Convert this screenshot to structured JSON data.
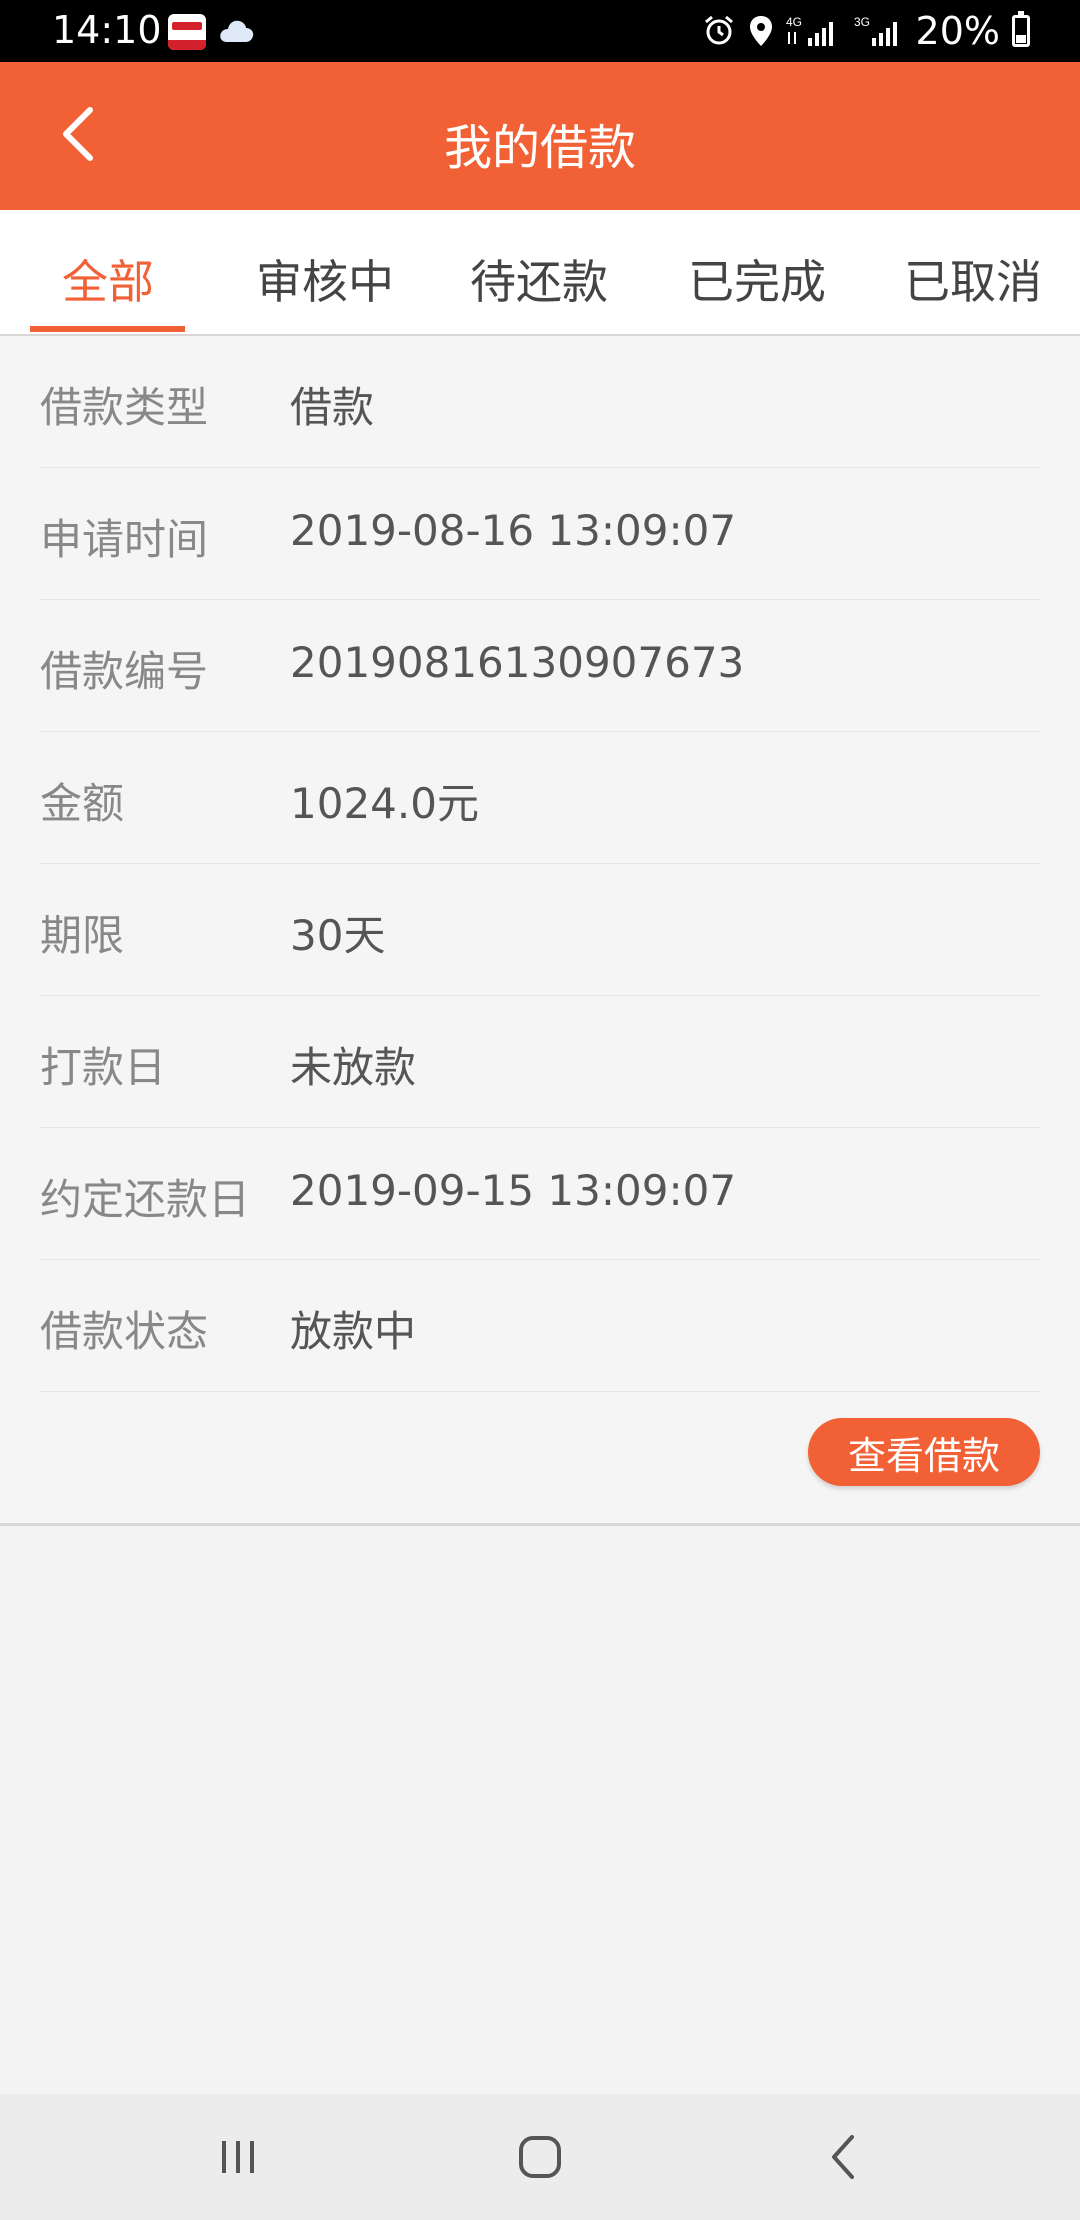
{
  "status_bar": {
    "time": "14:10",
    "battery": "20%",
    "icons": [
      "app-notification-icon",
      "cloud-icon",
      "alarm-icon",
      "location-icon",
      "signal-4g-icon",
      "signal-3g-icon",
      "battery-charging-icon"
    ]
  },
  "header": {
    "title": "我的借款",
    "back_icon": "chevron-left-icon"
  },
  "tabs": [
    {
      "label": "全部",
      "active": true
    },
    {
      "label": "审核中",
      "active": false
    },
    {
      "label": "待还款",
      "active": false
    },
    {
      "label": "已完成",
      "active": false
    },
    {
      "label": "已取消",
      "active": false
    }
  ],
  "loan": {
    "rows": [
      {
        "label": "借款类型",
        "value": "借款"
      },
      {
        "label": "申请时间",
        "value": "2019-08-16 13:09:07"
      },
      {
        "label": "借款编号",
        "value": "20190816130907673"
      },
      {
        "label": "金额",
        "value": "1024.0元"
      },
      {
        "label": "期限",
        "value": "30天"
      },
      {
        "label": "打款日",
        "value": "未放款"
      },
      {
        "label": "约定还款日",
        "value": "2019-09-15 13:09:07"
      },
      {
        "label": "借款状态",
        "value": "放款中"
      }
    ],
    "action_button": "查看借款"
  },
  "colors": {
    "accent": "#f26135",
    "label_text": "#888888",
    "value_text": "#555555",
    "background": "#f4f4f4"
  },
  "nav_bar": {
    "icons": [
      "recent-apps-icon",
      "home-icon",
      "back-icon"
    ]
  }
}
